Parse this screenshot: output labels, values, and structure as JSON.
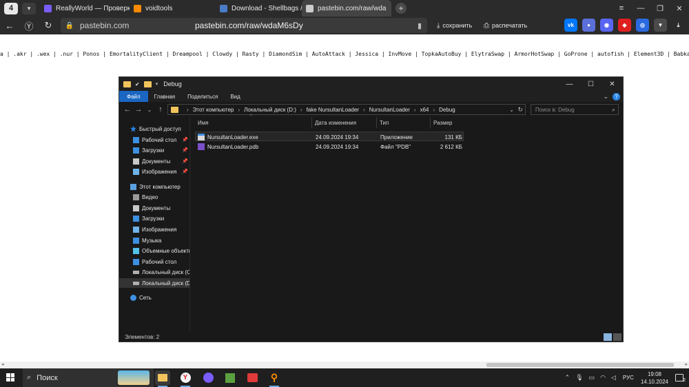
{
  "browser": {
    "tab_counter": "4",
    "tabs": [
      {
        "title": "ReallyWorld — Проверка",
        "favicon_color": "#7a5cff"
      },
      {
        "title": "voidtools",
        "favicon_color": "#ff8a00"
      },
      {
        "title": "Download - Shellbags /",
        "favicon_color": "#4a7cc7"
      },
      {
        "title": "pastebin.com/raw/wda",
        "favicon_color": "#cccccc"
      }
    ],
    "url_host": "pastebin.com",
    "url_full": "pastebin.com/raw/wdaM6sDy",
    "save_label": "сохранить",
    "print_label": "распечатать"
  },
  "page": {
    "text": "a | .akr | .wex | .nur | Ponos | EmortalityClient | Dreampool | Clowdy | Rasty | DiamondSim | AutoAttack | Jessica | InvMove | TopkaAutoBuy | ElytraSwap | ArmorHotSwap | GoProne | autofish | Element3D | BabkaLogs"
  },
  "explorer": {
    "title": "Debug",
    "ribbon": {
      "file": "Файл",
      "home": "Главная",
      "share": "Поделиться",
      "view": "Вид"
    },
    "breadcrumbs": [
      "Этот компьютер",
      "Локальный диск (D:)",
      "fake NursultanLoader",
      "NursultanLoader",
      "x64",
      "Debug"
    ],
    "search_placeholder": "Поиск в: Debug",
    "sidebar": [
      {
        "label": "Быстрый доступ",
        "icon": "star-icon"
      },
      {
        "label": "Рабочий стол",
        "icon": "desktop-icon"
      },
      {
        "label": "Загрузки",
        "icon": "download-icon"
      },
      {
        "label": "Документы",
        "icon": "documents-icon"
      },
      {
        "label": "Изображения",
        "icon": "pictures-icon"
      },
      {
        "label": "Этот компьютер",
        "icon": "computer-icon"
      },
      {
        "label": "Видео",
        "icon": "video-icon"
      },
      {
        "label": "Документы",
        "icon": "documents-icon"
      },
      {
        "label": "Загрузки",
        "icon": "download-icon"
      },
      {
        "label": "Изображения",
        "icon": "pictures-icon"
      },
      {
        "label": "Музыка",
        "icon": "music-icon"
      },
      {
        "label": "Объемные объекты",
        "icon": "3d-objects-icon"
      },
      {
        "label": "Рабочий стол",
        "icon": "desktop-icon"
      },
      {
        "label": "Локальный диск (C:)",
        "icon": "drive-icon"
      },
      {
        "label": "Локальный диск (D:)",
        "icon": "drive-icon"
      },
      {
        "label": "Сеть",
        "icon": "network-icon"
      }
    ],
    "columns": {
      "name": "Имя",
      "date": "Дата изменения",
      "type": "Тип",
      "size": "Размер"
    },
    "files": [
      {
        "name": "NursultanLoader.exe",
        "date": "24.09.2024 19:34",
        "type": "Приложение",
        "size": "131 КБ"
      },
      {
        "name": "NursultanLoader.pdb",
        "date": "24.09.2024 19:34",
        "type": "Файл \"PDB\"",
        "size": "2 612 КБ"
      }
    ],
    "status": "Элементов: 2"
  },
  "taskbar": {
    "search_label": "Поиск",
    "lang": "РУС",
    "time": "19:08",
    "date": "14.10.2024",
    "notifications": "2"
  }
}
